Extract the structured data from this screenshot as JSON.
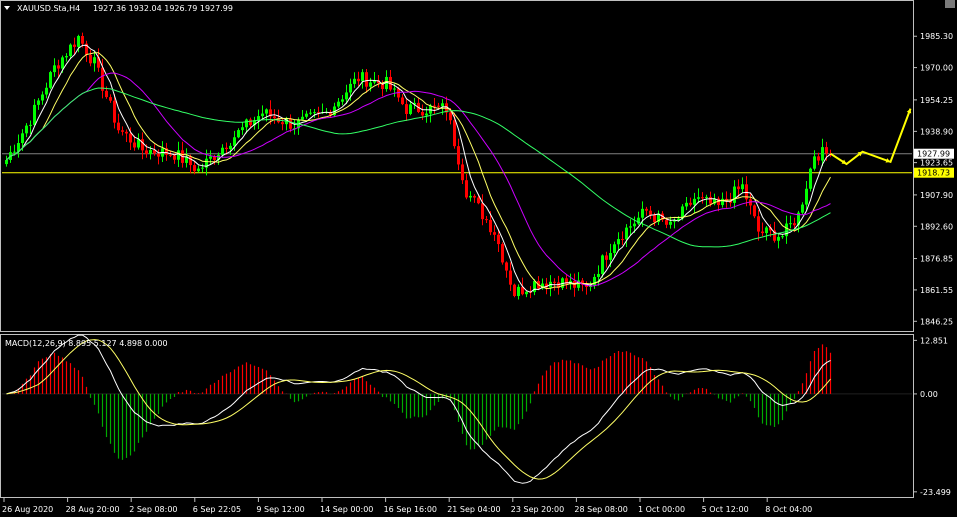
{
  "header": {
    "title": "XAUUSD.Sta,H4",
    "ohlc": "1927.36 1932.04 1926.79 1927.99",
    "menu_icon": "triangle-down-icon"
  },
  "colors": {
    "background": "#000000",
    "bull": "#00ff00",
    "bear": "#ff0000",
    "ma_fast": "#ffffff",
    "ma_mid": "#ffff66",
    "ma_slow": "#cc00ff",
    "ma_long": "#33ff66",
    "horizontal_line": "#ffff00",
    "forecast_arrow": "#ffff00",
    "macd_main": "#ffffff",
    "macd_signal": "#ffff66",
    "hist_pos": "#ff0000",
    "hist_neg": "#00aa00",
    "grid": "#c0c0c0"
  },
  "chart_data": [
    {
      "type": "candlestick",
      "title": "XAUUSD.Sta,H4",
      "ylim": [
        1842,
        2002
      ],
      "yticks": [
        "1985.30",
        "1970.00",
        "1954.25",
        "1938.90",
        "1923.65",
        "1907.90",
        "1892.60",
        "1876.85",
        "1861.55",
        "1846.25"
      ],
      "price_labels": [
        {
          "text": "1927.99",
          "value": 1927.99,
          "style": "current"
        },
        {
          "text": "1918.73",
          "value": 1918.73,
          "style": "hline"
        }
      ],
      "xticks": [
        "26 Aug 2020",
        "28 Aug 20:00",
        "2 Sep 08:00",
        "6 Sep 22:05",
        "9 Sep 12:00",
        "14 Sep 00:00",
        "16 Sep 16:00",
        "21 Sep 04:00",
        "23 Sep 20:00",
        "28 Sep 08:00",
        "1 Oct 00:00",
        "5 Oct 12:00",
        "8 Oct 04:00"
      ],
      "anchors": [
        {
          "bar": 0,
          "price": 1925
        },
        {
          "bar": 6,
          "price": 1945
        },
        {
          "bar": 12,
          "price": 1970
        },
        {
          "bar": 18,
          "price": 1985
        },
        {
          "bar": 22,
          "price": 1972
        },
        {
          "bar": 28,
          "price": 1940
        },
        {
          "bar": 34,
          "price": 1930
        },
        {
          "bar": 42,
          "price": 1928
        },
        {
          "bar": 48,
          "price": 1920
        },
        {
          "bar": 56,
          "price": 1935
        },
        {
          "bar": 64,
          "price": 1948
        },
        {
          "bar": 72,
          "price": 1942
        },
        {
          "bar": 80,
          "price": 1948
        },
        {
          "bar": 88,
          "price": 1965
        },
        {
          "bar": 95,
          "price": 1962
        },
        {
          "bar": 100,
          "price": 1950
        },
        {
          "bar": 110,
          "price": 1950
        },
        {
          "bar": 115,
          "price": 1910
        },
        {
          "bar": 122,
          "price": 1890
        },
        {
          "bar": 127,
          "price": 1860
        },
        {
          "bar": 132,
          "price": 1865
        },
        {
          "bar": 138,
          "price": 1866
        },
        {
          "bar": 145,
          "price": 1862
        },
        {
          "bar": 152,
          "price": 1886
        },
        {
          "bar": 160,
          "price": 1900
        },
        {
          "bar": 166,
          "price": 1892
        },
        {
          "bar": 172,
          "price": 1906
        },
        {
          "bar": 178,
          "price": 1902
        },
        {
          "bar": 184,
          "price": 1912
        },
        {
          "bar": 188,
          "price": 1890
        },
        {
          "bar": 194,
          "price": 1888
        },
        {
          "bar": 198,
          "price": 1898
        },
        {
          "bar": 202,
          "price": 1928
        },
        {
          "bar": 206,
          "price": 1928
        }
      ],
      "bar_count": 207,
      "forecast_path": [
        {
          "bar": 206,
          "price": 1928
        },
        {
          "bar": 210,
          "price": 1923
        },
        {
          "bar": 214,
          "price": 1929
        },
        {
          "bar": 221,
          "price": 1924
        },
        {
          "bar": 226,
          "price": 1950
        }
      ],
      "series": [
        {
          "name": "MA fast",
          "period": 5
        },
        {
          "name": "MA mid",
          "period": 10
        },
        {
          "name": "MA slow",
          "period": 21
        },
        {
          "name": "MA long",
          "period": 60
        }
      ]
    },
    {
      "type": "macd",
      "label": "MACD(12,26,9) 8.895 5.127 4.898 0.000",
      "ylim": [
        -24.5,
        13.9
      ],
      "yticks": [
        "12.851",
        "0.00",
        "-23.499"
      ]
    }
  ]
}
